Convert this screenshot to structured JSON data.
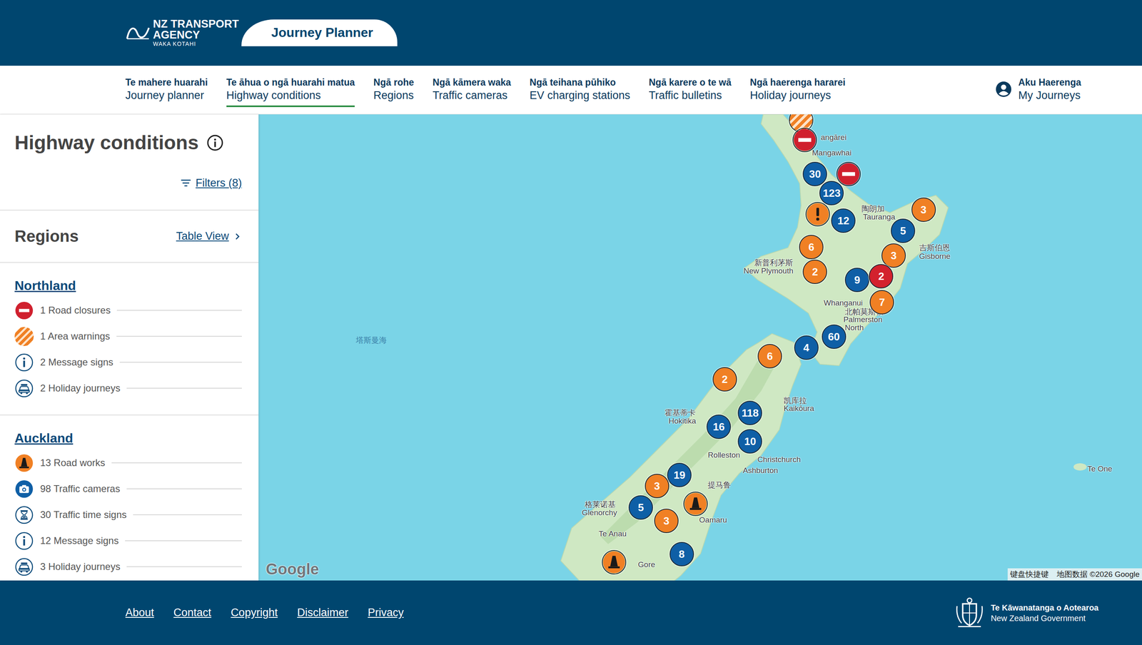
{
  "header": {
    "logo": {
      "line1": "NZ TRANSPORT",
      "line2": "AGENCY",
      "line3": "WAKA KOTAHI"
    },
    "app_title": "Journey Planner"
  },
  "nav": {
    "items": [
      {
        "small": "Te mahere huarahi",
        "label": "Journey planner",
        "selected": false
      },
      {
        "small": "Te āhua o ngā huarahi matua",
        "label": "Highway conditions",
        "selected": true
      },
      {
        "small": "Ngā rohe",
        "label": "Regions",
        "selected": false
      },
      {
        "small": "Ngā kāmera waka",
        "label": "Traffic cameras",
        "selected": false
      },
      {
        "small": "Ngā teihana pūhiko",
        "label": "EV charging stations",
        "selected": false
      },
      {
        "small": "Ngā karere o te wā",
        "label": "Traffic bulletins",
        "selected": false
      },
      {
        "small": "Ngā haerenga hararei",
        "label": "Holiday journeys",
        "selected": false
      }
    ],
    "account": {
      "small": "Aku Haerenga",
      "label": "My Journeys"
    }
  },
  "sidebar": {
    "title": "Highway conditions",
    "filters": "Filters (8)",
    "regions_heading": "Regions",
    "table_view": "Table View",
    "regions": [
      {
        "name": "Northland",
        "items": [
          {
            "text": "1 Road closures",
            "kind": "closure"
          },
          {
            "text": "1 Area warnings",
            "kind": "area"
          },
          {
            "text": "2 Message signs",
            "kind": "message"
          },
          {
            "text": "2 Holiday journeys",
            "kind": "holiday"
          }
        ]
      },
      {
        "name": "Auckland",
        "items": [
          {
            "text": "13 Road works",
            "kind": "roadworks"
          },
          {
            "text": "98 Traffic cameras",
            "kind": "camera"
          },
          {
            "text": "30 Traffic time signs",
            "kind": "timesign"
          },
          {
            "text": "12 Message signs",
            "kind": "message"
          },
          {
            "text": "3 Holiday journeys",
            "kind": "holiday"
          }
        ]
      }
    ]
  },
  "map": {
    "labels": [
      {
        "text": "angārei",
        "kind": "place"
      },
      {
        "text": "Mangawhai",
        "kind": "place"
      },
      {
        "text": "陶朗加",
        "kind": "place"
      },
      {
        "text": "Tauranga",
        "kind": "place"
      },
      {
        "text": "吉斯伯恩",
        "kind": "place"
      },
      {
        "text": "Gisborne",
        "kind": "place"
      },
      {
        "text": "新普利茅斯",
        "kind": "place"
      },
      {
        "text": "New Plymouth",
        "kind": "place"
      },
      {
        "text": "Whanganui",
        "kind": "place"
      },
      {
        "text": "北帕莫斯顿",
        "kind": "place"
      },
      {
        "text": "Palmerston",
        "kind": "place"
      },
      {
        "text": "North",
        "kind": "place"
      },
      {
        "text": "塔斯曼海",
        "kind": "sea"
      },
      {
        "text": "凯库拉",
        "kind": "place"
      },
      {
        "text": "Kaikōura",
        "kind": "place"
      },
      {
        "text": "霍基蒂卡",
        "kind": "place"
      },
      {
        "text": "Hokitika",
        "kind": "place"
      },
      {
        "text": "Rolleston",
        "kind": "place"
      },
      {
        "text": "Christchurch",
        "kind": "place"
      },
      {
        "text": "Ashburton",
        "kind": "place"
      },
      {
        "text": "提马鲁",
        "kind": "place"
      },
      {
        "text": "Oamaru",
        "kind": "place"
      },
      {
        "text": "格莱诺基",
        "kind": "place"
      },
      {
        "text": "Glenorchy",
        "kind": "place"
      },
      {
        "text": "Te Anau",
        "kind": "place"
      },
      {
        "text": "Gore",
        "kind": "place"
      },
      {
        "text": "Te One",
        "kind": "place"
      }
    ],
    "markers": [
      {
        "kind": "area"
      },
      {
        "kind": "closure"
      },
      {
        "kind": "cluster",
        "count": "30",
        "color": "#0f5fa6"
      },
      {
        "kind": "closure"
      },
      {
        "kind": "cluster",
        "count": "123",
        "color": "#0f5fa6"
      },
      {
        "kind": "warning"
      },
      {
        "kind": "cluster",
        "count": "12",
        "color": "#0f5fa6"
      },
      {
        "kind": "cluster",
        "count": "3",
        "color": "#f08024"
      },
      {
        "kind": "cluster",
        "count": "5",
        "color": "#0f5fa6"
      },
      {
        "kind": "cluster",
        "count": "3",
        "color": "#f08024"
      },
      {
        "kind": "cluster",
        "count": "6",
        "color": "#f08024"
      },
      {
        "kind": "cluster",
        "count": "2",
        "color": "#f08024"
      },
      {
        "kind": "cluster",
        "count": "7",
        "color": "#f08024"
      },
      {
        "kind": "cluster",
        "count": "9",
        "color": "#0f5fa6"
      },
      {
        "kind": "cluster",
        "count": "2",
        "color": "#d3212d"
      },
      {
        "kind": "cluster",
        "count": "4",
        "color": "#0f5fa6"
      },
      {
        "kind": "cluster",
        "count": "60",
        "color": "#0f5fa6"
      },
      {
        "kind": "cluster",
        "count": "6",
        "color": "#f08024"
      },
      {
        "kind": "cluster",
        "count": "2",
        "color": "#f08024"
      },
      {
        "kind": "cluster",
        "count": "118",
        "color": "#0f5fa6"
      },
      {
        "kind": "cluster",
        "count": "16",
        "color": "#0f5fa6"
      },
      {
        "kind": "cluster",
        "count": "10",
        "color": "#0f5fa6"
      },
      {
        "kind": "cluster",
        "count": "19",
        "color": "#0f5fa6"
      },
      {
        "kind": "cluster",
        "count": "3",
        "color": "#f08024"
      },
      {
        "kind": "roadworks"
      },
      {
        "kind": "cluster",
        "count": "3",
        "color": "#f08024"
      },
      {
        "kind": "cluster",
        "count": "5",
        "color": "#0f5fa6"
      },
      {
        "kind": "cluster",
        "count": "8",
        "color": "#0f5fa6"
      },
      {
        "kind": "roadworks"
      }
    ],
    "logo": "Google",
    "attribution": [
      "键盘快捷键",
      "地图数据 ©2026 Google"
    ]
  },
  "footer": {
    "links": [
      "About",
      "Contact",
      "Copyright",
      "Disclaimer",
      "Privacy"
    ],
    "government": {
      "line1": "Te Kāwanatanga o Aotearoa",
      "line2": "New Zealand Government"
    }
  }
}
